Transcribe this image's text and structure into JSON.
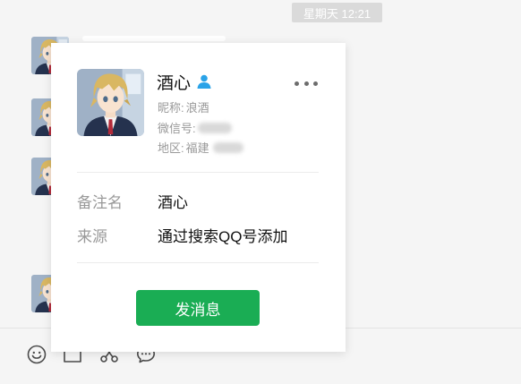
{
  "chat": {
    "timestamp": "星期天 12:21"
  },
  "profile_card": {
    "name": "酒心",
    "nickname_label": "昵称:",
    "nickname_value": "浪酒",
    "wechat_id_label": "微信号:",
    "region_label": "地区:",
    "region_value": "福建",
    "remark_label": "备注名",
    "remark_value": "酒心",
    "source_label": "来源",
    "source_value": "通过搜索QQ号添加",
    "send_message_label": "发消息"
  },
  "colors": {
    "send_button": "#1aad54",
    "friend_icon": "#2aa3e8",
    "page_background": "#f5f5f5"
  },
  "icons": {
    "friend": "person-icon",
    "more": "more-dots-icon",
    "emoji": "emoji-icon",
    "file": "folder-icon",
    "screenshot": "scissors-icon",
    "chat_history": "chat-bubble-icon"
  }
}
